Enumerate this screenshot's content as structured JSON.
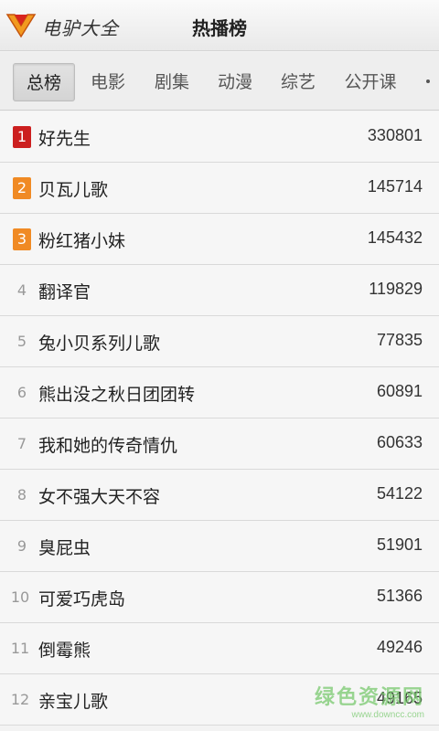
{
  "header": {
    "app_name": "电驴大全",
    "title": "热播榜",
    "logo_icon": "v-logo-icon"
  },
  "tabs": [
    {
      "label": "总榜",
      "active": true
    },
    {
      "label": "电影",
      "active": false
    },
    {
      "label": "剧集",
      "active": false
    },
    {
      "label": "动漫",
      "active": false
    },
    {
      "label": "综艺",
      "active": false
    },
    {
      "label": "公开课",
      "active": false
    }
  ],
  "rank_colors": {
    "1": "#cc1f1f",
    "2": "#f08a24",
    "3": "#f08a24"
  },
  "list": [
    {
      "rank": "1",
      "title": "好先生",
      "count": "330801"
    },
    {
      "rank": "2",
      "title": "贝瓦儿歌",
      "count": "145714"
    },
    {
      "rank": "3",
      "title": "粉红猪小妹",
      "count": "145432"
    },
    {
      "rank": "4",
      "title": "翻译官",
      "count": "119829"
    },
    {
      "rank": "5",
      "title": "兔小贝系列儿歌",
      "count": "77835"
    },
    {
      "rank": "6",
      "title": "熊出没之秋日团团转",
      "count": "60891"
    },
    {
      "rank": "7",
      "title": "我和她的传奇情仇",
      "count": "60633"
    },
    {
      "rank": "8",
      "title": "女不强大天不容",
      "count": "54122"
    },
    {
      "rank": "9",
      "title": "臭屁虫",
      "count": "51901"
    },
    {
      "rank": "10",
      "title": "可爱巧虎岛",
      "count": "51366"
    },
    {
      "rank": "11",
      "title": "倒霉熊",
      "count": "49246"
    },
    {
      "rank": "12",
      "title": "亲宝儿歌",
      "count": "49165"
    }
  ],
  "watermark": {
    "text": "绿色资源网",
    "url": "www.downcc.com"
  }
}
